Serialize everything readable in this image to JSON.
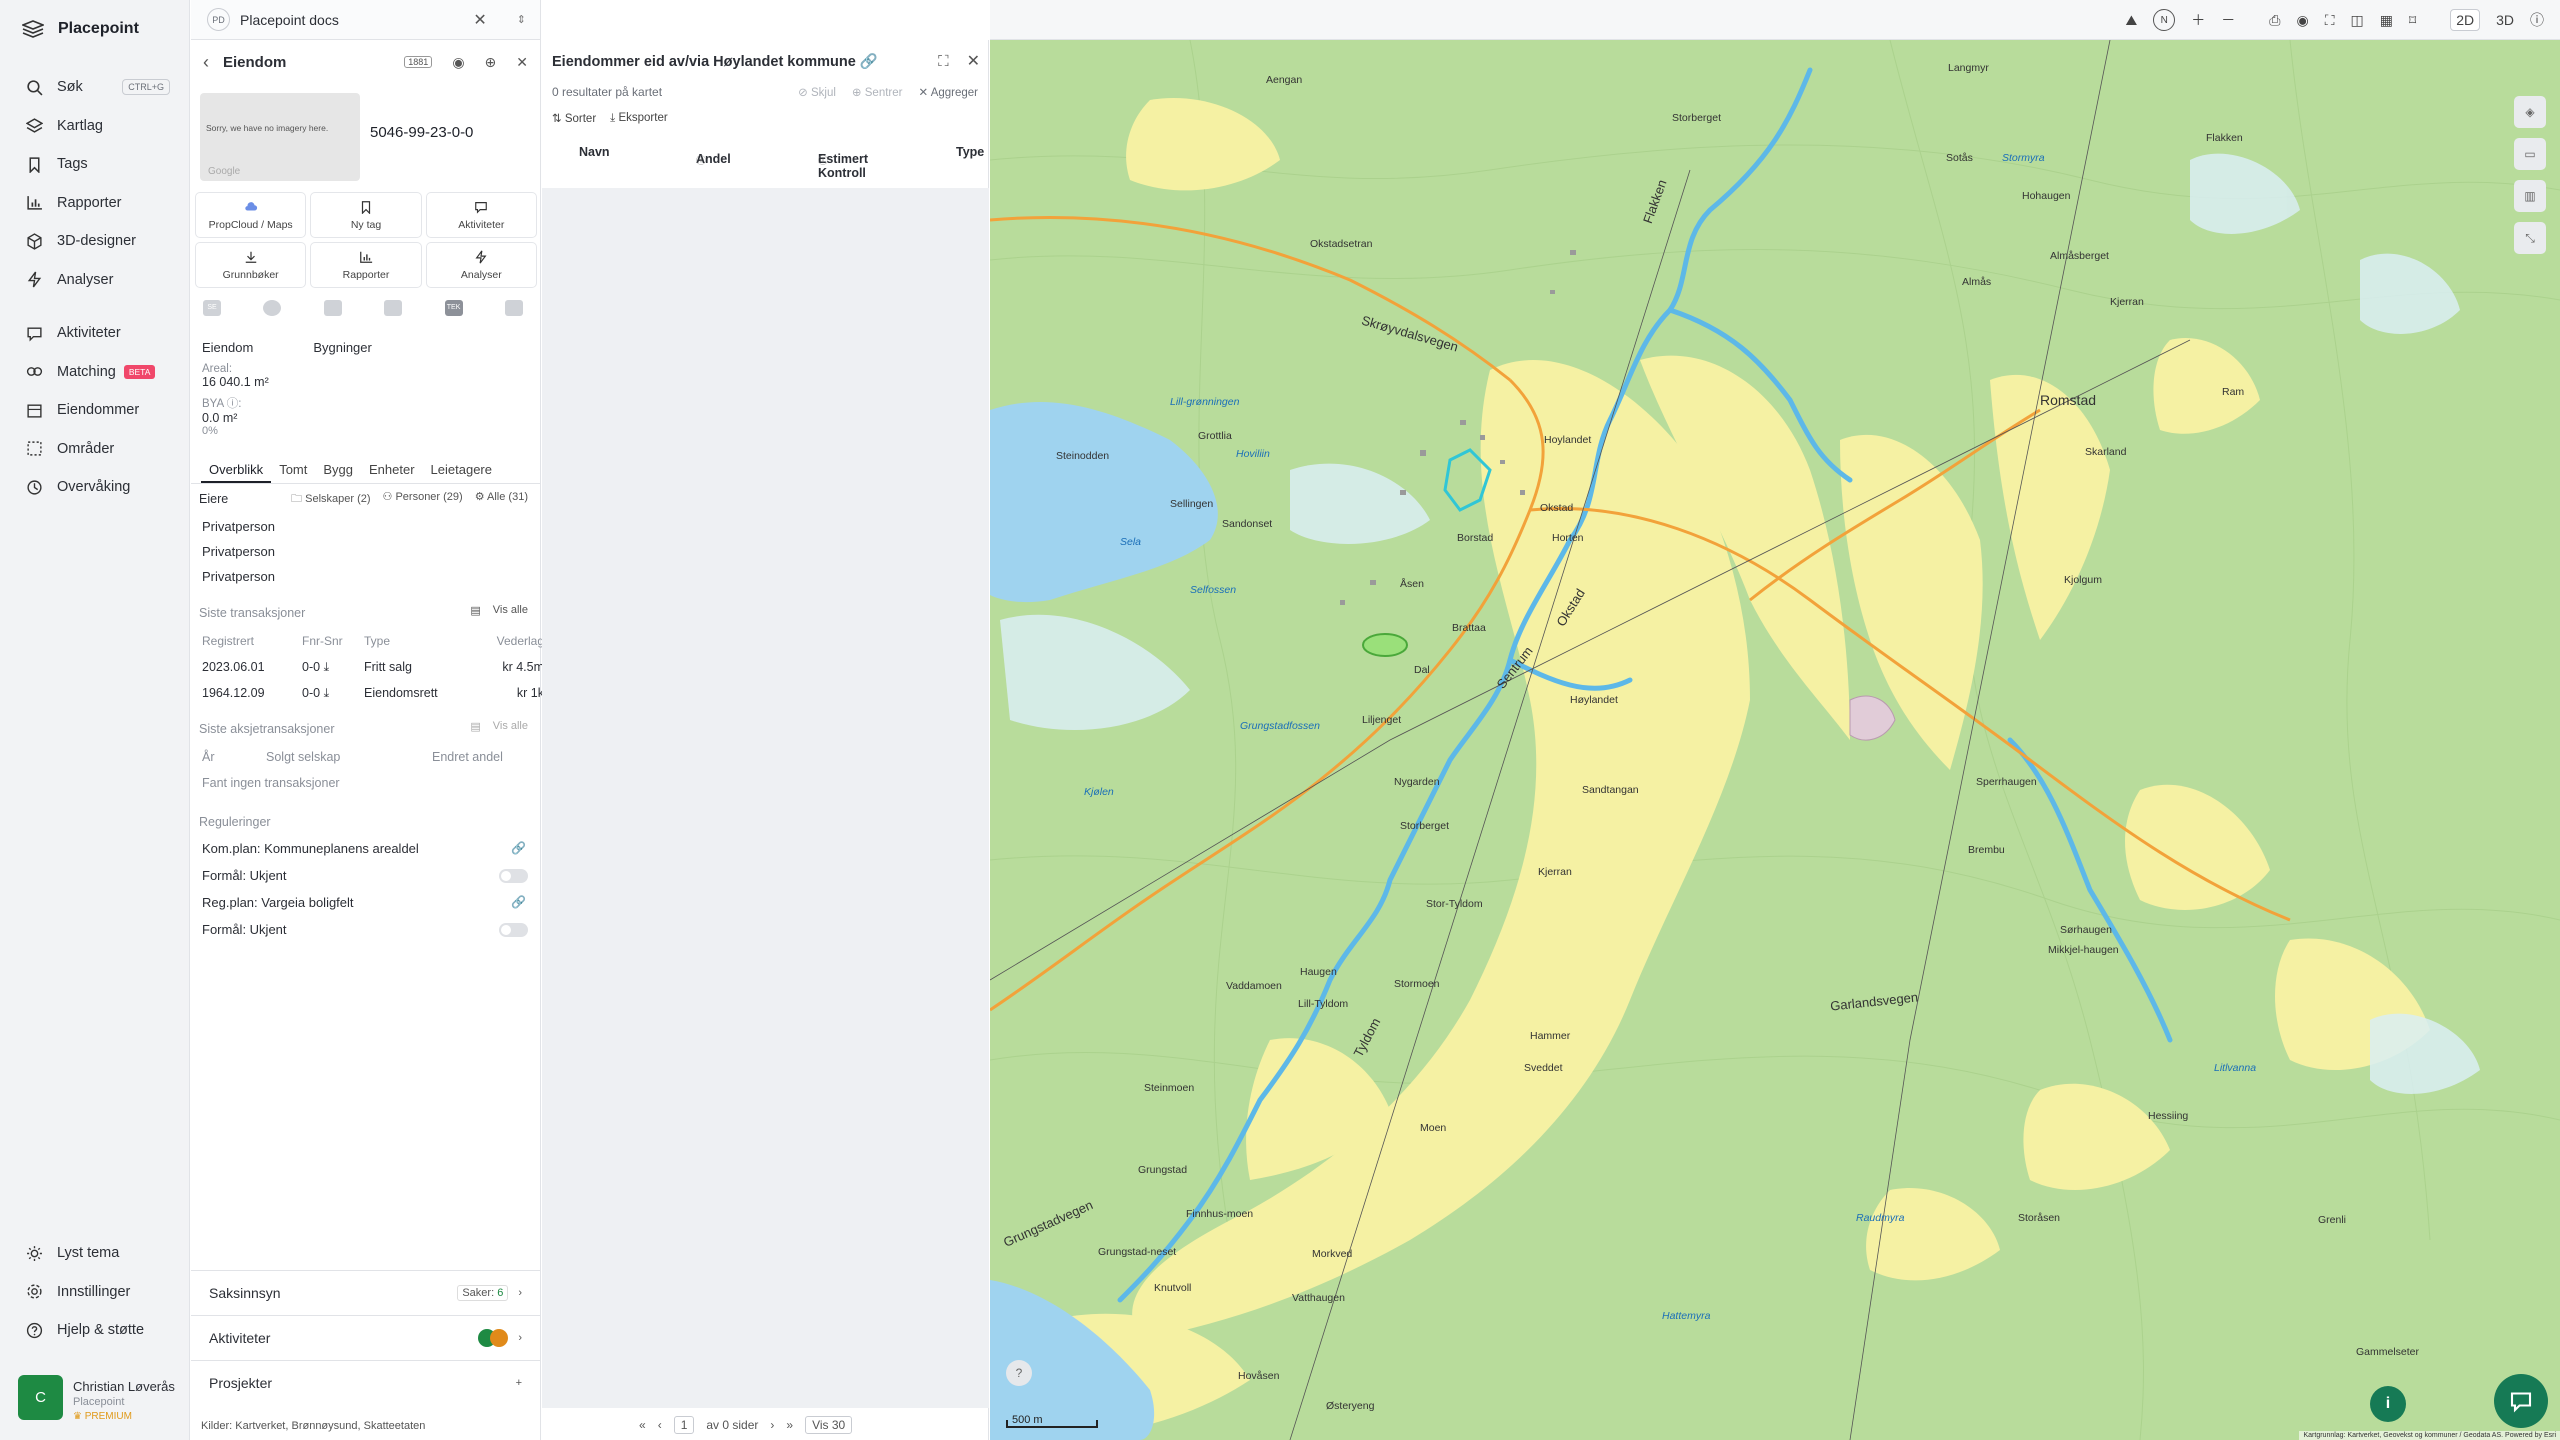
{
  "sidebar": {
    "brand": "Placepoint",
    "items": [
      {
        "label": "Søk",
        "icon": "search-icon",
        "shortcut": "CTRL+G"
      },
      {
        "label": "Kartlag",
        "icon": "layers-icon"
      },
      {
        "label": "Tags",
        "icon": "bookmark-icon"
      },
      {
        "label": "Rapporter",
        "icon": "chart-icon"
      },
      {
        "label": "3D-designer",
        "icon": "cube-icon"
      },
      {
        "label": "Analyser",
        "icon": "bolt-icon"
      }
    ],
    "items2": [
      {
        "label": "Aktiviteter",
        "icon": "chat-icon"
      },
      {
        "label": "Matching",
        "icon": "matching-icon",
        "badge": "BETA"
      },
      {
        "label": "Eiendommer",
        "icon": "building-icon"
      },
      {
        "label": "Områder",
        "icon": "area-icon"
      },
      {
        "label": "Overvåking",
        "icon": "monitor-icon"
      }
    ],
    "bottom": [
      {
        "label": "Lyst tema",
        "icon": "sun-icon"
      },
      {
        "label": "Innstillinger",
        "icon": "gear-icon"
      },
      {
        "label": "Hjelp & støtte",
        "icon": "help-icon"
      }
    ],
    "user": {
      "initial": "C",
      "name": "Christian Løverås",
      "org": "Placepoint",
      "plan": "PREMIUM"
    }
  },
  "tab": {
    "badge": "PD",
    "title": "Placepoint docs"
  },
  "property": {
    "title": "Eiendom",
    "badge": "1881",
    "thumb_text": "Sorry, we have no imagery here.",
    "thumb_credit": "Google",
    "id": "5046-99-23-0-0",
    "actions": [
      "PropCloud / Maps",
      "Ny tag",
      "Aktiviteter",
      "Grunnbøker",
      "Rapporter",
      "Analyser"
    ],
    "icon_row": [
      "SE",
      "TEK"
    ],
    "col1": "Eiendom",
    "col2": "Bygninger",
    "areal_label": "Areal:",
    "areal_value": "16 040.1",
    "areal_unit": "m²",
    "bya_label": "BYA ⓘ:",
    "bya_value": "0.0 m²",
    "bya_pct": "0%",
    "tabs": [
      "Overblikk",
      "Tomt",
      "Bygg",
      "Enheter",
      "Leietagere"
    ],
    "owners_title": "Eiere",
    "owner_filters": [
      "Selskaper (2)",
      "Personer (29)",
      "Alle (31)"
    ],
    "owners": [
      "Privatperson",
      "Privatperson",
      "Privatperson"
    ],
    "tx_title": "Siste transaksjoner",
    "tx_showall": "Vis alle",
    "tx_headers": [
      "Registrert",
      "Fnr-Snr",
      "Type",
      "Vederlag"
    ],
    "tx_rows": [
      [
        "2023.06.01",
        "0-0",
        "Fritt salg",
        "kr 4.5m"
      ],
      [
        "1964.12.09",
        "0-0",
        "Eiendomsrett",
        "kr 1k"
      ]
    ],
    "share_title": "Siste aksjetransaksjoner",
    "share_showall": "Vis alle",
    "share_headers": [
      "År",
      "Solgt selskap",
      "Endret andel"
    ],
    "share_empty": "Fant ingen transaksjoner",
    "reg_title": "Reguleringer",
    "regs": [
      "Kom.plan: Kommuneplanens arealdel",
      "Formål: Ukjent",
      "Reg.plan: Vargeia boligfelt",
      "Formål: Ukjent"
    ],
    "acc": [
      {
        "label": "Saksinnsyn",
        "right": "Saker:",
        "count": "6"
      },
      {
        "label": "Aktiviteter"
      },
      {
        "label": "Prosjekter",
        "right": "+"
      }
    ],
    "sources": "Kilder: Kartverket, Brønnøysund, Skatteetaten"
  },
  "owned": {
    "title": "Eiendommer eid av/via Høylandet kommune",
    "count": "0 resultater på kartet",
    "actions": [
      "Skjul",
      "Sentrer",
      "Aggreger"
    ],
    "tools": [
      "Sorter",
      "Eksporter"
    ],
    "columns": [
      "Navn",
      "Andel",
      "Estimert Kontroll",
      "Type"
    ],
    "pager_of": "av 0 sider",
    "pager_page": "1",
    "pager_show": "Vis 30"
  },
  "map": {
    "view2d": "2D",
    "view3d": "3D",
    "scale": "500 m",
    "attribution": "Kartgrunnlag: Kartverket, Geovekst og kommuner / Geodata AS. Powered by Esri",
    "place_labels": [
      "Langmyr",
      "Aengan",
      "Flakken",
      "Storberget",
      "Sotås",
      "Hohaugen",
      "Okstadsetran",
      "Almåsberget",
      "Almås",
      "Kjerran",
      "Romstad",
      "Ram",
      "Hoylandet",
      "Skarland",
      "Okstad",
      "Horten",
      "Kjolgum",
      "Borstad",
      "Åsen",
      "Brattaa",
      "Høylandet",
      "Dal",
      "Liljenget",
      "Nygarden",
      "Sandtangan",
      "Storberget",
      "Sperrhaugen",
      "Brembu",
      "Stor-Tyldom",
      "Kjerran",
      "Sørhaugen",
      "Mikkjel-haugen",
      "Haugen",
      "Lill-Tyldom",
      "Stormoen",
      "Vaddamoen",
      "Hammer",
      "Sveddet",
      "Steinmoen",
      "Moen",
      "Hessiing",
      "Grungstad",
      "Finnhus-moen",
      "Grungstad-neset",
      "Knutvoll",
      "Morkved",
      "Vatthaugen",
      "Storåsen",
      "Grenli",
      "Hovåsen",
      "Østeryeng",
      "Gammelseter",
      "Steinodden",
      "Grottlia",
      "Sellingen",
      "Sandonset"
    ],
    "water_labels": [
      "Stormyra",
      "Lill-grønningen",
      "Hoviliin",
      "Sela",
      "Selfossen",
      "Kjølen",
      "Grungstadfossen",
      "Raudmyra",
      "Hattemyra",
      "Litlvanna"
    ],
    "road_labels": [
      "Skrøyvdalsvegen",
      "Sentrum",
      "Okstad",
      "Tyldom",
      "Garlandsvegen",
      "Grungstadvegen",
      "Flakken"
    ]
  }
}
